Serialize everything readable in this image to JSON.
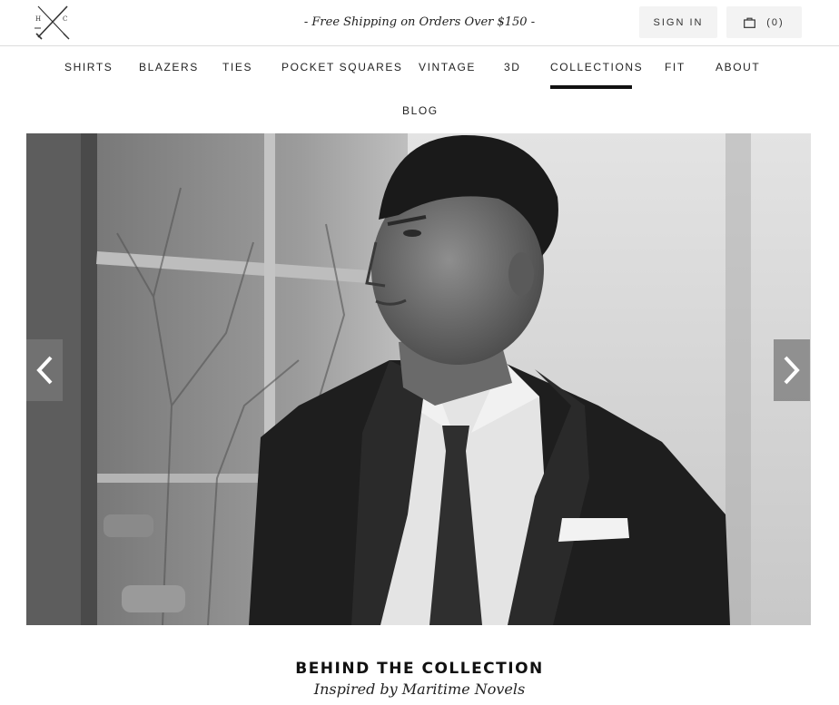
{
  "header": {
    "logo_letters": [
      "H",
      "C"
    ],
    "promo_text": "- Free Shipping on Orders Over $150 -",
    "sign_in_label": "SIGN IN",
    "cart_count": "(0)"
  },
  "nav": {
    "items": [
      {
        "label": "SHIRTS"
      },
      {
        "label": "BLAZERS"
      },
      {
        "label": "TIES"
      },
      {
        "label": "POCKET SQUARES"
      },
      {
        "label": "VINTAGE"
      },
      {
        "label": "3D"
      },
      {
        "label": "COLLECTIONS",
        "active": true
      },
      {
        "label": "FIT"
      },
      {
        "label": "ABOUT"
      },
      {
        "label": "BLOG"
      }
    ]
  },
  "hero": {
    "prev_icon": "chevron-left-icon",
    "next_icon": "chevron-right-icon"
  },
  "caption": {
    "title": "BEHIND THE COLLECTION",
    "subtitle": "Inspired by Maritime Novels"
  },
  "colors": {
    "text": "#222222",
    "active_underline": "#111111",
    "button_bg": "#f3f3f3",
    "border": "#dcdcdc"
  }
}
